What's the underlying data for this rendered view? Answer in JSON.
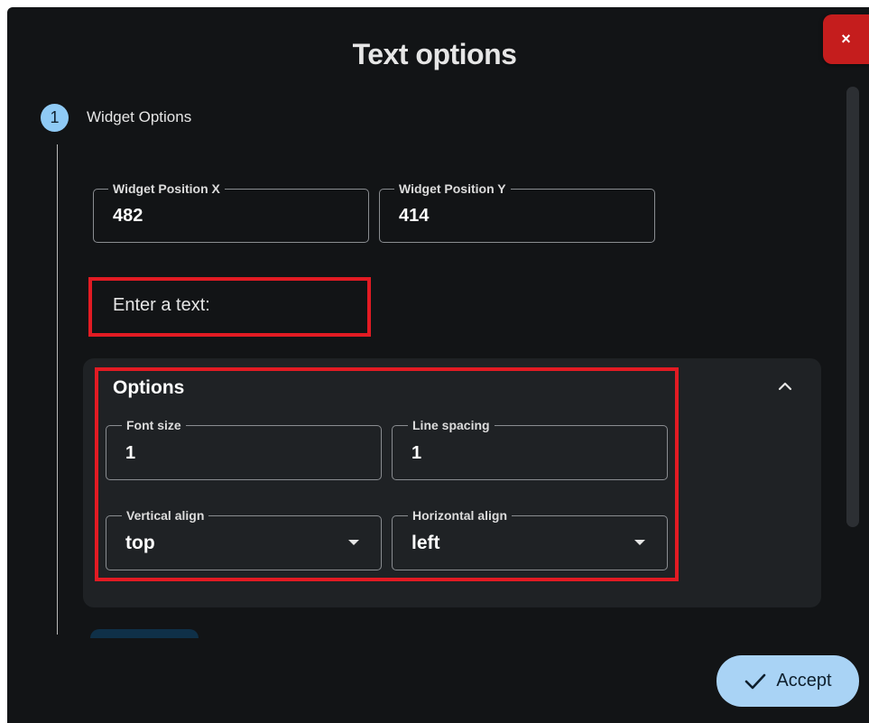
{
  "dialog": {
    "title": "Text options",
    "close_label": "×"
  },
  "stepper": {
    "step_number": "1",
    "step_label": "Widget Options"
  },
  "position": {
    "x_label": "Widget Position X",
    "x_value": "482",
    "y_label": "Widget Position Y",
    "y_value": "414"
  },
  "text_input": {
    "placeholder": "Enter a text:"
  },
  "options": {
    "title": "Options",
    "font_size_label": "Font size",
    "font_size_value": "1",
    "line_spacing_label": "Line spacing",
    "line_spacing_value": "1",
    "vertical_align_label": "Vertical align",
    "vertical_align_value": "top",
    "horizontal_align_label": "Horizontal align",
    "horizontal_align_value": "left"
  },
  "footer": {
    "accept_label": "Accept"
  },
  "colors": {
    "background": "#121416",
    "panel": "#1f2225",
    "accent": "#a9d3f5",
    "close": "#c51d1d",
    "highlight": "#e21b23"
  }
}
